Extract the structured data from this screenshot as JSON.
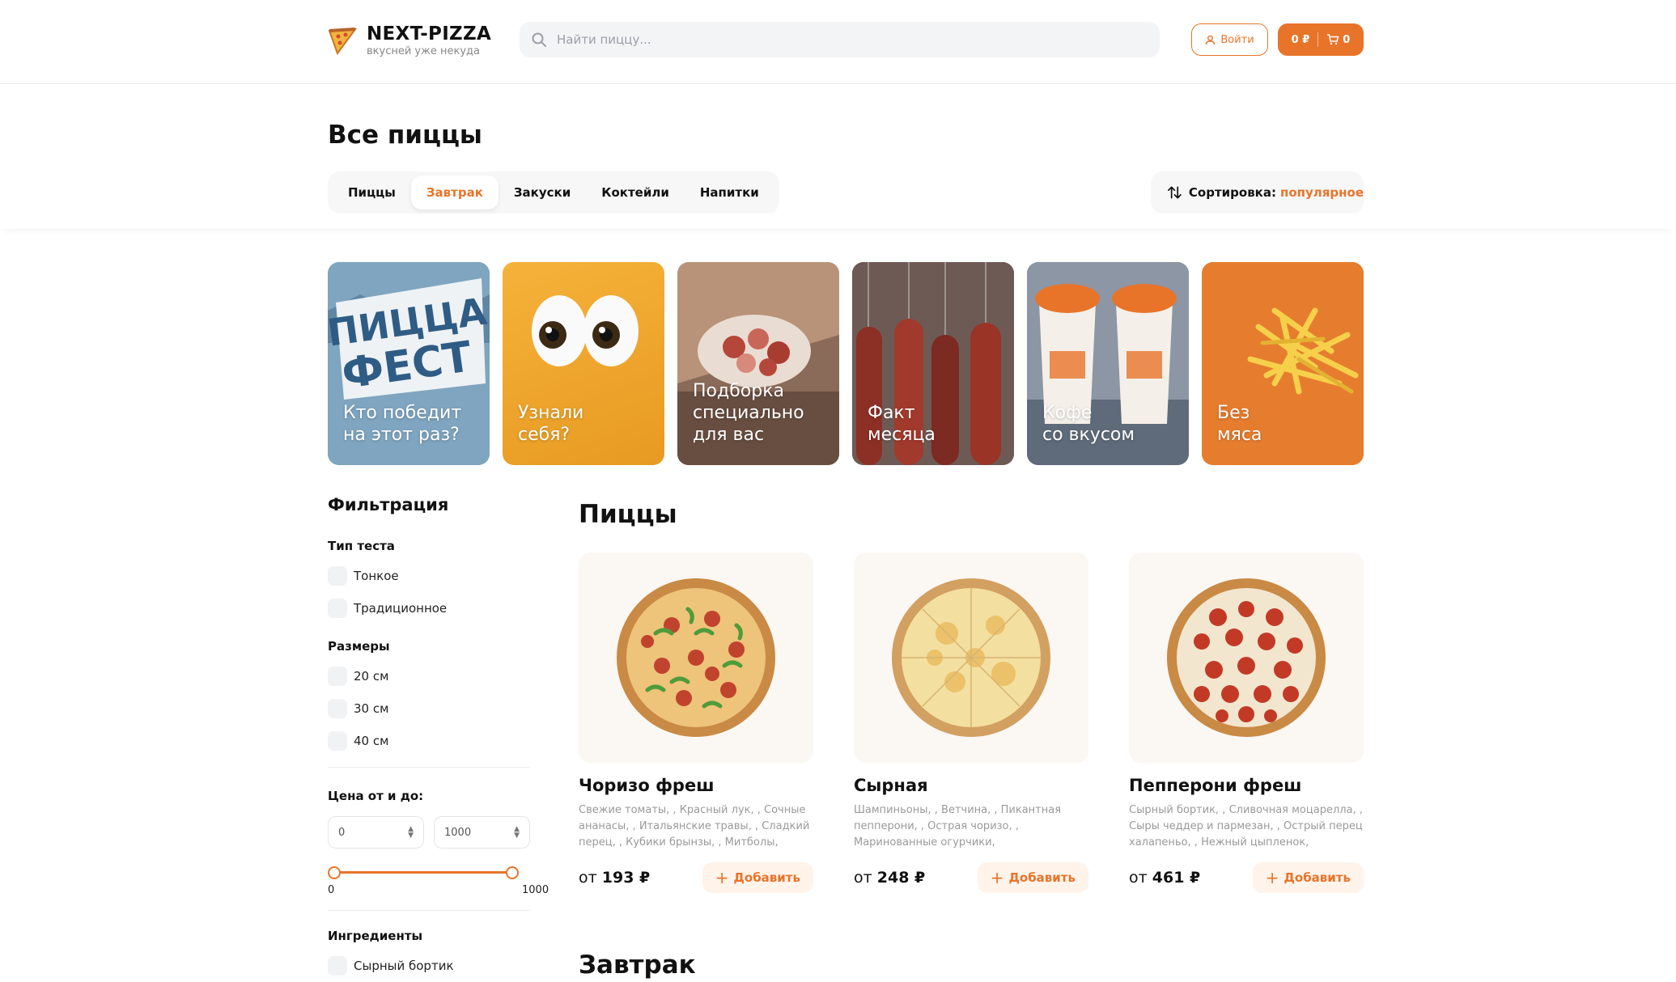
{
  "header": {
    "logo_title": "NEXT-PIZZA",
    "logo_subtitle": "вкусней уже некуда",
    "search_placeholder": "Найти пиццу...",
    "login_label": "Войти",
    "cart_total": "0 ₽",
    "cart_count": "0",
    "accent_color": "#e8742a"
  },
  "page": {
    "title": "Все пиццы"
  },
  "categories": [
    {
      "label": "Пиццы",
      "active": false
    },
    {
      "label": "Завтрак",
      "active": true
    },
    {
      "label": "Закуски",
      "active": false
    },
    {
      "label": "Коктейли",
      "active": false
    },
    {
      "label": "Напитки",
      "active": false
    }
  ],
  "sort": {
    "label": "Сортировка:",
    "value": "популярное"
  },
  "stories": [
    {
      "text": "Кто победит\nна этот раз?",
      "color": "#7fa5c0"
    },
    {
      "text": "Узнали\nсебя?",
      "color": "#f0a52a"
    },
    {
      "text": "Подборка\nспециально\nдля вас",
      "color": "#a8846a"
    },
    {
      "text": "Факт\nмесяца",
      "color": "#6e4a40"
    },
    {
      "text": "Кофе\nсо вкусом",
      "color": "#7e8a9a"
    },
    {
      "text": "Без\nмяса",
      "color": "#e67d2e"
    }
  ],
  "filter": {
    "title": "Фильтрация",
    "dough_title": "Тип теста",
    "dough_options": [
      "Тонкое",
      "Традиционное"
    ],
    "sizes_title": "Размеры",
    "sizes_options": [
      "20 см",
      "30 см",
      "40 см"
    ],
    "price_title": "Цена от и до:",
    "price_from": "0",
    "price_to": "1000",
    "slider_min_label": "0",
    "slider_max_label": "1000",
    "ingredients_title": "Ингредиенты",
    "ingredients_options": [
      "Сырный бортик"
    ]
  },
  "sections": {
    "pizzas_title": "Пиццы",
    "breakfast_title": "Завтрак"
  },
  "products": [
    {
      "name": "Чоризо фреш",
      "desc": "Свежие томаты, , Красный лук, , Сочные ананасы, , Итальянские травы, , Сладкий перец, , Кубики брынзы, , Митболы,",
      "price_prefix": "от",
      "price": "193 ₽",
      "add_label": "Добавить"
    },
    {
      "name": "Сырная",
      "desc": "Шампиньоны, , Ветчина, , Пикантная пепперони, , Острая чоризо, , Маринованные огурчики,",
      "price_prefix": "от",
      "price": "248 ₽",
      "add_label": "Добавить"
    },
    {
      "name": "Пепперони фреш",
      "desc": "Сырный бортик, , Сливочная моцарелла, , Сыры чеддер и пармезан, , Острый перец халапеньо, , Нежный цыпленок,",
      "price_prefix": "от",
      "price": "461 ₽",
      "add_label": "Добавить"
    }
  ]
}
